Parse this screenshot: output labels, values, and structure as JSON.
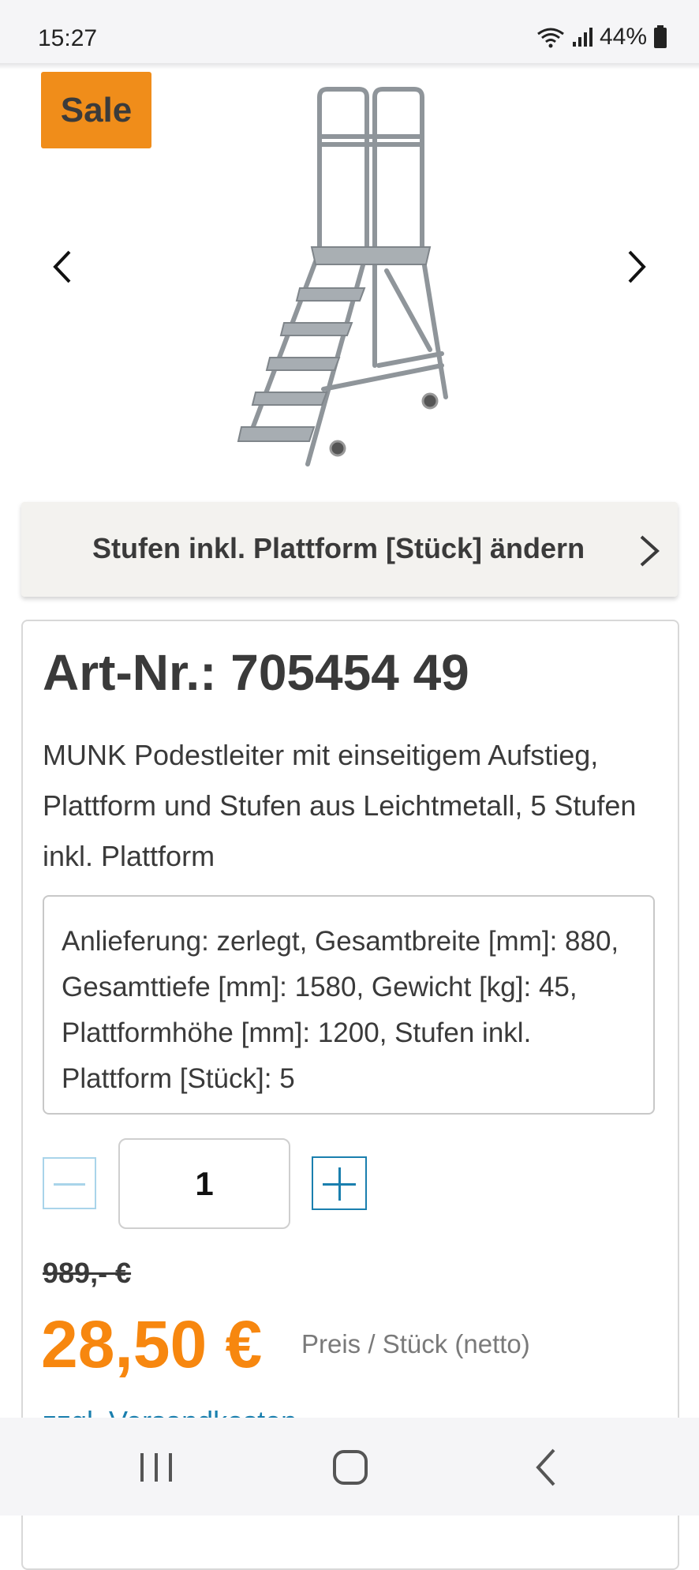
{
  "status_bar": {
    "time": "15:27",
    "battery": "44%"
  },
  "gallery": {
    "badge": "Sale",
    "image_alt": "MUNK Podestleiter"
  },
  "variant": {
    "label": "Stufen inkl. Plattform [Stück] ändern"
  },
  "product": {
    "art_nr": "Art-Nr.: 705454 49",
    "description": "MUNK Podestleiter mit einseitigem Aufstieg, Plattform und Stufen aus Leichtmetall, 5 Stufen inkl. Plattform",
    "specs": "Anlieferung: zerlegt, Gesamtbreite [mm]: 880, Gesamttiefe [mm]: 1580, Gewicht [kg]: 45, Plattformhöhe [mm]: 1200, Stufen inkl. Plattform [Stück]: 5"
  },
  "quantity": {
    "value": "1"
  },
  "pricing": {
    "old_price": "989,- €",
    "price": "28,50 €",
    "unit_label": "Preis / Stück (netto)",
    "cut_link": "zzgl. Versandkosten"
  },
  "colors": {
    "accent": "#f7870f",
    "badge": "#f08d1a",
    "link": "#1a7fae"
  },
  "icons": {
    "prev": "chevron-left-icon",
    "next": "chevron-right-icon",
    "recents": "recents-icon",
    "home": "home-icon",
    "back": "back-icon"
  }
}
